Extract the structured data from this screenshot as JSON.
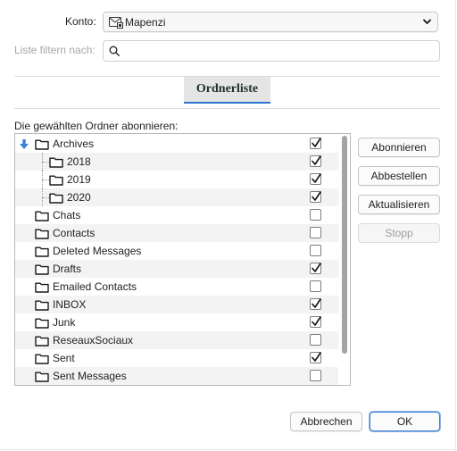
{
  "account": {
    "label": "Konto:",
    "value": "Mapenzi",
    "icon": "mail-account-icon"
  },
  "filter": {
    "label": "Liste filtern nach:",
    "value": "",
    "placeholder": ""
  },
  "tab": {
    "label": "Ordnerliste"
  },
  "subscribe_label": "Die gewählten Ordner abonnieren:",
  "folders": [
    {
      "name": "Archives",
      "checked": true,
      "level": 0,
      "expanded": true
    },
    {
      "name": "2018",
      "checked": true,
      "level": 1
    },
    {
      "name": "2019",
      "checked": true,
      "level": 1
    },
    {
      "name": "2020",
      "checked": true,
      "level": 1
    },
    {
      "name": "Chats",
      "checked": false,
      "level": 0
    },
    {
      "name": "Contacts",
      "checked": false,
      "level": 0
    },
    {
      "name": "Deleted Messages",
      "checked": false,
      "level": 0
    },
    {
      "name": "Drafts",
      "checked": true,
      "level": 0
    },
    {
      "name": "Emailed Contacts",
      "checked": false,
      "level": 0
    },
    {
      "name": "INBOX",
      "checked": true,
      "level": 0
    },
    {
      "name": "Junk",
      "checked": true,
      "level": 0
    },
    {
      "name": "ReseauxSociaux",
      "checked": false,
      "level": 0
    },
    {
      "name": "Sent",
      "checked": true,
      "level": 0
    },
    {
      "name": "Sent Messages",
      "checked": false,
      "level": 0
    }
  ],
  "side_buttons": {
    "subscribe": "Abonnieren",
    "unsubscribe": "Abbestellen",
    "refresh": "Aktualisieren",
    "stop": "Stopp"
  },
  "footer": {
    "cancel": "Abbrechen",
    "ok": "OK"
  },
  "colors": {
    "accent": "#2a76d2",
    "tab_background": "#e5e5e5"
  }
}
